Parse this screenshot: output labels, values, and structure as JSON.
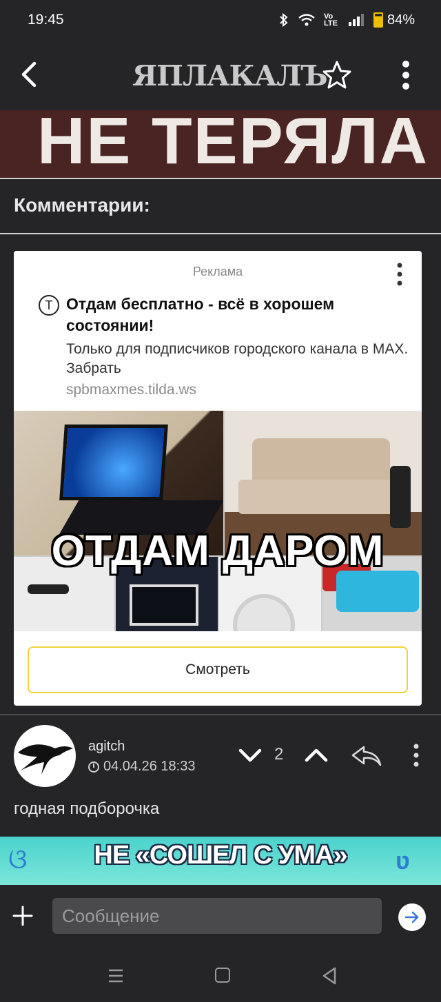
{
  "status_bar": {
    "time": "19:45",
    "battery": "84%",
    "network": "Vo LTE"
  },
  "header": {
    "logo": "ЯПЛАКАЛЪ"
  },
  "post": {
    "banner_text": "НЕ ТЕРЯЛА"
  },
  "comments_section": {
    "title": "Комментарии:"
  },
  "ad": {
    "label": "Реклама",
    "headline": "Отдам бесплатно - всё в хорошем состоянии!",
    "description": "Только для подписчиков городского канала в MAX. Забрать",
    "domain": "spbmaxmes.tilda.ws",
    "image_text": "ОТДАМ ДАРОМ",
    "cta": "Смотреть",
    "logo_letter": "T"
  },
  "comment": {
    "author": "agitch",
    "date": "04.04.26 18:33",
    "votes": "2",
    "text": "годная подборочка",
    "image_text": "НЕ «СОШЕЛ С УМА»"
  },
  "composer": {
    "placeholder": "Сообщение"
  },
  "colors": {
    "background": "#252527",
    "ad_button_border": "#f3d23a",
    "banner_bg": "#4a2422"
  },
  "icons": [
    "back-icon",
    "star-icon",
    "more-vert-icon",
    "clock-icon",
    "chevron-down-icon",
    "chevron-up-icon",
    "reply-icon",
    "plus-icon",
    "send-icon"
  ]
}
